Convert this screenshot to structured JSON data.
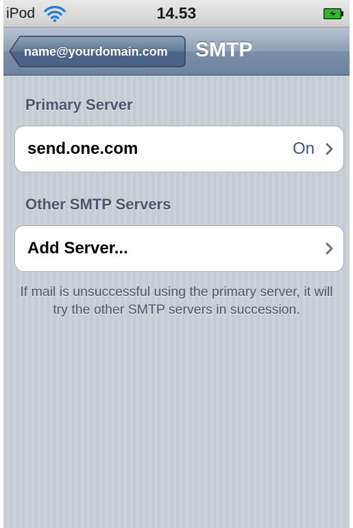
{
  "status_bar": {
    "carrier": "iPod",
    "time": "14.53",
    "wifi_icon": "wifi-icon",
    "battery_icon": "battery-charging-icon"
  },
  "nav_bar": {
    "back_label": "name@yourdomain.com",
    "title": "SMTP"
  },
  "sections": {
    "primary": {
      "header": "Primary Server",
      "server_name": "send.one.com",
      "server_status": "On"
    },
    "other": {
      "header": "Other SMTP Servers",
      "add_label": "Add Server..."
    },
    "footer": "If mail is unsuccessful using the primary server, it will try the other SMTP servers in succession."
  },
  "colors": {
    "nav_bar": "#7a8ea7",
    "background": "#c5ccd4",
    "section_text": "#4c566c",
    "value_text": "#385487",
    "battery": "#2fb82f"
  }
}
